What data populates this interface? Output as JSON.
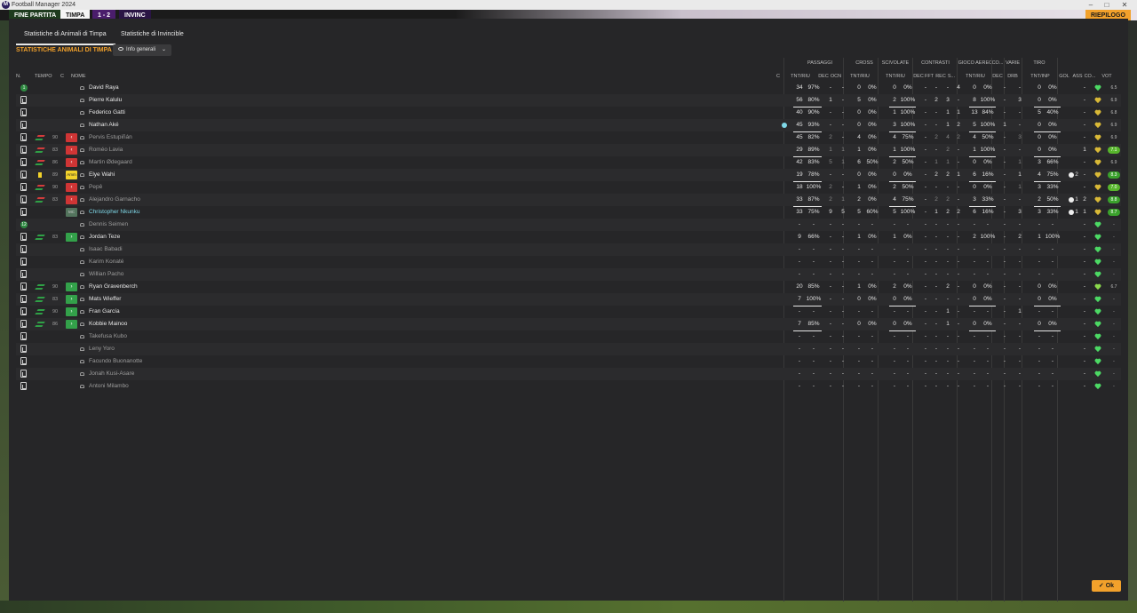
{
  "window": {
    "title": "Football Manager 2024",
    "app_icon": "M"
  },
  "topbar": {
    "end_button": "FINE PARTITA",
    "home_team": "TIMPA",
    "away_team": "INVINC",
    "score": "1 - 2",
    "right_label": "RIEPILOGO"
  },
  "tabs": [
    {
      "label": "Statistiche di Animali di Timpa",
      "active": true
    },
    {
      "label": "Statistiche di Invincible",
      "active": false
    }
  ],
  "section_title": "STATISTICHE ANIMALI DI TIMPA",
  "view_select": "Info generali",
  "groups": [
    "PASSAGGI",
    "CROSS",
    "SCIVOLATE",
    "CONTRASTI",
    "GIOCO AEREO",
    "CO...",
    "VARIE",
    "TIRO"
  ],
  "headers": {
    "n": "N.",
    "tempo": "TEMPO",
    "c": "C",
    "nome": "NOME",
    "c2": "C",
    "pass_tnt": "TNT/RIU",
    "pass_dec": "DEC",
    "pass_ocn": "OCN",
    "cross_tnt": "TNT/RIU",
    "scv_tnt": "TNT/RIU",
    "con_dec": "DEC",
    "con_fft": "FFT",
    "con_rec": "REC",
    "con_s": "S...",
    "aer_tnt": "TNT/RIU",
    "co_dec": "DEC",
    "var_drb": "DRB",
    "tiro_tnt": "TNT/INP",
    "gol": "GOL",
    "ass": "ASS",
    "cond": "CO...",
    "vot": "VOT"
  },
  "players": [
    {
      "n": "1",
      "starter": true,
      "evt": "",
      "tempo": "",
      "pos": "",
      "name": "David Raya",
      "style": "",
      "pt": "34",
      "pp": "97%",
      "pdec": "-",
      "pocn": "-",
      "ct": "0",
      "cp": "0%",
      "st": "0",
      "sp": "0%",
      "kdec": "-",
      "kfft": "-",
      "krec": "-",
      "ks": "4",
      "at": "0",
      "ap": "0%",
      "codec": "-",
      "drb": "-",
      "tt": "0",
      "tp": "0%",
      "gol": "",
      "ass": "-",
      "cond": "green",
      "vot": "6.5"
    },
    {
      "n": "",
      "starter": false,
      "evt": "",
      "tempo": "",
      "pos": "",
      "name": "Pierre Kalulu",
      "style": "",
      "pt": "56",
      "pp": "80%",
      "pdec": "1",
      "pocn": "-",
      "ct": "5",
      "cp": "0%",
      "st": "2",
      "sp": "100%",
      "kdec": "-",
      "kfft": "2",
      "krec": "3",
      "ks": "-",
      "at": "8",
      "ap": "100%",
      "codec": "-",
      "drb": "3",
      "tt": "0",
      "tp": "0%",
      "gol": "",
      "ass": "-",
      "cond": "yellow",
      "vot": "6.9"
    },
    {
      "n": "",
      "starter": false,
      "evt": "",
      "tempo": "",
      "pos": "",
      "name": "Federico Gatti",
      "style": "",
      "pt": "40",
      "pp": "90%",
      "pdec": "-",
      "pocn": "-",
      "ct": "0",
      "cp": "0%",
      "st": "1",
      "sp": "100%",
      "kdec": "-",
      "kfft": "-",
      "krec": "1",
      "ks": "1",
      "at": "13",
      "ap": "84%",
      "codec": "-",
      "drb": "-",
      "tt": "5",
      "tp": "40%",
      "gol": "",
      "ass": "-",
      "cond": "yellow",
      "vot": "6.8"
    },
    {
      "n": "",
      "starter": false,
      "evt": "",
      "tempo": "",
      "pos": "",
      "name": "Nathan Aké",
      "style": "",
      "pt": "45",
      "pp": "93%",
      "pdec": "-",
      "pocn": "-",
      "ct": "0",
      "cp": "0%",
      "st": "3",
      "sp": "100%",
      "kdec": "-",
      "kfft": "-",
      "krec": "1",
      "ks": "2",
      "at": "5",
      "ap": "100%",
      "codec": "1",
      "drb": "-",
      "tt": "0",
      "tp": "0%",
      "gol": "",
      "ass": "-",
      "cond": "yellow",
      "vot": "6.9"
    },
    {
      "n": "",
      "starter": false,
      "evt": "sub",
      "tempo": "90",
      "pos": "red",
      "name": "Pervis Estupiñán",
      "style": "dim",
      "pt": "45",
      "pp": "82%",
      "pdec": "2",
      "pocn": "-",
      "ct": "4",
      "cp": "0%",
      "st": "4",
      "sp": "75%",
      "kdec": "-",
      "kfft": "2",
      "krec": "4",
      "ks": "2",
      "at": "4",
      "ap": "50%",
      "codec": "-",
      "drb": "3",
      "tt": "0",
      "tp": "0%",
      "gol": "",
      "ass": "-",
      "cond": "yellow",
      "vot": "6.9"
    },
    {
      "n": "",
      "starter": false,
      "evt": "sub",
      "tempo": "83",
      "pos": "red",
      "name": "Roméo Lavia",
      "style": "dim",
      "pt": "29",
      "pp": "89%",
      "pdec": "1",
      "pocn": "1",
      "ct": "1",
      "cp": "0%",
      "st": "1",
      "sp": "100%",
      "kdec": "-",
      "kfft": "-",
      "krec": "2",
      "ks": "-",
      "at": "1",
      "ap": "100%",
      "codec": "-",
      "drb": "-",
      "tt": "0",
      "tp": "0%",
      "gol": "",
      "ass": "1",
      "cond": "yellow",
      "vot": "7.1"
    },
    {
      "n": "",
      "starter": false,
      "evt": "sub",
      "tempo": "86",
      "pos": "red",
      "name": "Martin Ødegaard",
      "style": "dim",
      "pt": "42",
      "pp": "83%",
      "pdec": "5",
      "pocn": "1",
      "ct": "6",
      "cp": "50%",
      "st": "2",
      "sp": "50%",
      "kdec": "-",
      "kfft": "1",
      "krec": "1",
      "ks": "-",
      "at": "0",
      "ap": "0%",
      "codec": "-",
      "drb": "1",
      "tt": "3",
      "tp": "66%",
      "gol": "",
      "ass": "-",
      "cond": "yellow",
      "vot": "6.9"
    },
    {
      "n": "",
      "starter": false,
      "evt": "yellow",
      "tempo": "89",
      "pos": "yellow",
      "posl": "Amm",
      "name": "Elye Wahi",
      "style": "",
      "pt": "19",
      "pp": "78%",
      "pdec": "-",
      "pocn": "-",
      "ct": "0",
      "cp": "0%",
      "st": "0",
      "sp": "0%",
      "kdec": "-",
      "kfft": "2",
      "krec": "2",
      "ks": "1",
      "at": "6",
      "ap": "16%",
      "codec": "-",
      "drb": "1",
      "tt": "4",
      "tp": "75%",
      "gol": "2",
      "ass": "-",
      "cond": "yellow",
      "vot": "8.3"
    },
    {
      "n": "",
      "starter": false,
      "evt": "sub",
      "tempo": "90",
      "pos": "red",
      "name": "Pepê",
      "style": "dim",
      "pt": "18",
      "pp": "100%",
      "pdec": "2",
      "pocn": "-",
      "ct": "1",
      "cp": "0%",
      "st": "2",
      "sp": "50%",
      "kdec": "-",
      "kfft": "-",
      "krec": "-",
      "ks": "-",
      "at": "0",
      "ap": "0%",
      "codec": "-",
      "drb": "1",
      "tt": "3",
      "tp": "33%",
      "gol": "",
      "ass": "-",
      "cond": "yellow",
      "vot": "7.0"
    },
    {
      "n": "",
      "starter": false,
      "evt": "sub",
      "tempo": "83",
      "pos": "red",
      "name": "Alejandro Garnacho",
      "style": "dim",
      "pt": "33",
      "pp": "87%",
      "pdec": "2",
      "pocn": "1",
      "ct": "2",
      "cp": "0%",
      "st": "4",
      "sp": "75%",
      "kdec": "-",
      "kfft": "2",
      "krec": "2",
      "ks": "-",
      "at": "3",
      "ap": "33%",
      "codec": "-",
      "drb": "-",
      "tt": "2",
      "tp": "50%",
      "gol": "1",
      "ass": "2",
      "cond": "yellow",
      "vot": "8.8"
    },
    {
      "n": "",
      "starter": false,
      "evt": "",
      "tempo": "",
      "pos": "gray",
      "posl": "MC",
      "name": "Christopher Nkunku",
      "style": "link",
      "pt": "33",
      "pp": "75%",
      "pdec": "9",
      "pocn": "5",
      "ct": "5",
      "cp": "60%",
      "st": "5",
      "sp": "100%",
      "kdec": "-",
      "kfft": "1",
      "krec": "2",
      "ks": "2",
      "at": "6",
      "ap": "16%",
      "codec": "-",
      "drb": "3",
      "tt": "3",
      "tp": "33%",
      "gol": "1",
      "ass": "1",
      "cond": "yellow",
      "vot": "8.7"
    },
    {
      "n": "12",
      "starter": true,
      "evt": "",
      "tempo": "",
      "pos": "",
      "name": "Dennis Seimen",
      "style": "dim",
      "pt": "-",
      "pp": "-",
      "pdec": "-",
      "pocn": "-",
      "ct": "-",
      "cp": "-",
      "st": "-",
      "sp": "-",
      "kdec": "-",
      "kfft": "-",
      "krec": "-",
      "ks": "-",
      "at": "-",
      "ap": "-",
      "codec": "-",
      "drb": "-",
      "tt": "-",
      "tp": "-",
      "gol": "",
      "ass": "-",
      "cond": "green",
      "vot": "-"
    },
    {
      "n": "",
      "starter": false,
      "evt": "subin",
      "tempo": "83",
      "pos": "green",
      "name": "Jordan Teze",
      "style": "",
      "pt": "9",
      "pp": "66%",
      "pdec": "-",
      "pocn": "-",
      "ct": "1",
      "cp": "0%",
      "st": "1",
      "sp": "0%",
      "kdec": "-",
      "kfft": "-",
      "krec": "-",
      "ks": "-",
      "at": "2",
      "ap": "100%",
      "codec": "-",
      "drb": "2",
      "tt": "1",
      "tp": "100%",
      "gol": "",
      "ass": "-",
      "cond": "green",
      "vot": "-"
    },
    {
      "n": "",
      "starter": false,
      "evt": "",
      "tempo": "",
      "pos": "",
      "name": "Isaac Babadi",
      "style": "dim",
      "pt": "-",
      "pp": "-",
      "pdec": "-",
      "pocn": "-",
      "ct": "-",
      "cp": "-",
      "st": "-",
      "sp": "-",
      "kdec": "-",
      "kfft": "-",
      "krec": "-",
      "ks": "-",
      "at": "-",
      "ap": "-",
      "codec": "-",
      "drb": "-",
      "tt": "-",
      "tp": "-",
      "gol": "",
      "ass": "-",
      "cond": "green",
      "vot": "-"
    },
    {
      "n": "",
      "starter": false,
      "evt": "",
      "tempo": "",
      "pos": "",
      "name": "Karim Konaté",
      "style": "dim",
      "pt": "-",
      "pp": "-",
      "pdec": "-",
      "pocn": "-",
      "ct": "-",
      "cp": "-",
      "st": "-",
      "sp": "-",
      "kdec": "-",
      "kfft": "-",
      "krec": "-",
      "ks": "-",
      "at": "-",
      "ap": "-",
      "codec": "-",
      "drb": "-",
      "tt": "-",
      "tp": "-",
      "gol": "",
      "ass": "-",
      "cond": "green",
      "vot": "-"
    },
    {
      "n": "",
      "starter": false,
      "evt": "",
      "tempo": "",
      "pos": "",
      "name": "Willian Pacho",
      "style": "dim",
      "pt": "-",
      "pp": "-",
      "pdec": "-",
      "pocn": "-",
      "ct": "-",
      "cp": "-",
      "st": "-",
      "sp": "-",
      "kdec": "-",
      "kfft": "-",
      "krec": "-",
      "ks": "-",
      "at": "-",
      "ap": "-",
      "codec": "-",
      "drb": "-",
      "tt": "-",
      "tp": "-",
      "gol": "",
      "ass": "-",
      "cond": "green",
      "vot": "-"
    },
    {
      "n": "",
      "starter": false,
      "evt": "subin",
      "tempo": "90",
      "pos": "green",
      "name": "Ryan Gravenberch",
      "style": "",
      "pt": "20",
      "pp": "85%",
      "pdec": "-",
      "pocn": "-",
      "ct": "1",
      "cp": "0%",
      "st": "2",
      "sp": "0%",
      "kdec": "-",
      "kfft": "-",
      "krec": "2",
      "ks": "-",
      "at": "0",
      "ap": "0%",
      "codec": "-",
      "drb": "-",
      "tt": "0",
      "tp": "0%",
      "gol": "",
      "ass": "-",
      "cond": "lime",
      "vot": "6.7"
    },
    {
      "n": "",
      "starter": false,
      "evt": "subin",
      "tempo": "83",
      "pos": "green",
      "name": "Mats Wieffer",
      "style": "",
      "pt": "7",
      "pp": "100%",
      "pdec": "-",
      "pocn": "-",
      "ct": "0",
      "cp": "0%",
      "st": "0",
      "sp": "0%",
      "kdec": "-",
      "kfft": "-",
      "krec": "-",
      "ks": "-",
      "at": "0",
      "ap": "0%",
      "codec": "-",
      "drb": "-",
      "tt": "0",
      "tp": "0%",
      "gol": "",
      "ass": "-",
      "cond": "green",
      "vot": "-"
    },
    {
      "n": "",
      "starter": false,
      "evt": "subin",
      "tempo": "90",
      "pos": "green",
      "name": "Fran García",
      "style": "",
      "pt": "-",
      "pp": "-",
      "pdec": "-",
      "pocn": "-",
      "ct": "-",
      "cp": "-",
      "st": "-",
      "sp": "-",
      "kdec": "-",
      "kfft": "-",
      "krec": "1",
      "ks": "-",
      "at": "-",
      "ap": "-",
      "codec": "-",
      "drb": "1",
      "tt": "-",
      "tp": "-",
      "gol": "",
      "ass": "-",
      "cond": "green",
      "vot": "-"
    },
    {
      "n": "",
      "starter": false,
      "evt": "subin",
      "tempo": "86",
      "pos": "green",
      "name": "Kobbie Mainoo",
      "style": "",
      "pt": "7",
      "pp": "85%",
      "pdec": "-",
      "pocn": "-",
      "ct": "0",
      "cp": "0%",
      "st": "0",
      "sp": "0%",
      "kdec": "-",
      "kfft": "-",
      "krec": "1",
      "ks": "-",
      "at": "0",
      "ap": "0%",
      "codec": "-",
      "drb": "-",
      "tt": "0",
      "tp": "0%",
      "gol": "",
      "ass": "-",
      "cond": "green",
      "vot": "-"
    },
    {
      "n": "",
      "starter": false,
      "evt": "",
      "tempo": "",
      "pos": "",
      "name": "Takefusa Kubo",
      "style": "dim",
      "pt": "-",
      "pp": "-",
      "pdec": "-",
      "pocn": "-",
      "ct": "-",
      "cp": "-",
      "st": "-",
      "sp": "-",
      "kdec": "-",
      "kfft": "-",
      "krec": "-",
      "ks": "-",
      "at": "-",
      "ap": "-",
      "codec": "-",
      "drb": "-",
      "tt": "-",
      "tp": "-",
      "gol": "",
      "ass": "-",
      "cond": "green",
      "vot": "-"
    },
    {
      "n": "",
      "starter": false,
      "evt": "",
      "tempo": "",
      "pos": "",
      "name": "Leny Yoro",
      "style": "dim",
      "pt": "-",
      "pp": "-",
      "pdec": "-",
      "pocn": "-",
      "ct": "-",
      "cp": "-",
      "st": "-",
      "sp": "-",
      "kdec": "-",
      "kfft": "-",
      "krec": "-",
      "ks": "-",
      "at": "-",
      "ap": "-",
      "codec": "-",
      "drb": "-",
      "tt": "-",
      "tp": "-",
      "gol": "",
      "ass": "-",
      "cond": "green",
      "vot": "-"
    },
    {
      "n": "",
      "starter": false,
      "evt": "",
      "tempo": "",
      "pos": "",
      "name": "Facundo Buonanotte",
      "style": "dim",
      "pt": "-",
      "pp": "-",
      "pdec": "-",
      "pocn": "-",
      "ct": "-",
      "cp": "-",
      "st": "-",
      "sp": "-",
      "kdec": "-",
      "kfft": "-",
      "krec": "-",
      "ks": "-",
      "at": "-",
      "ap": "-",
      "codec": "-",
      "drb": "-",
      "tt": "-",
      "tp": "-",
      "gol": "",
      "ass": "-",
      "cond": "green",
      "vot": "-"
    },
    {
      "n": "",
      "starter": false,
      "evt": "",
      "tempo": "",
      "pos": "",
      "name": "Jonah Kusi-Asare",
      "style": "dim",
      "pt": "-",
      "pp": "-",
      "pdec": "-",
      "pocn": "-",
      "ct": "-",
      "cp": "-",
      "st": "-",
      "sp": "-",
      "kdec": "-",
      "kfft": "-",
      "krec": "-",
      "ks": "-",
      "at": "-",
      "ap": "-",
      "codec": "-",
      "drb": "-",
      "tt": "-",
      "tp": "-",
      "gol": "",
      "ass": "-",
      "cond": "green",
      "vot": "-"
    },
    {
      "n": "",
      "starter": false,
      "evt": "",
      "tempo": "",
      "pos": "",
      "name": "Antoni Milambo",
      "style": "dim",
      "pt": "-",
      "pp": "-",
      "pdec": "-",
      "pocn": "-",
      "ct": "-",
      "cp": "-",
      "st": "-",
      "sp": "-",
      "kdec": "-",
      "kfft": "-",
      "krec": "-",
      "ks": "-",
      "at": "-",
      "ap": "-",
      "codec": "-",
      "drb": "-",
      "tt": "-",
      "tp": "-",
      "gol": "",
      "ass": "-",
      "cond": "green",
      "vot": "-"
    }
  ],
  "ok_button": "Ok",
  "colors": {
    "accent": "#f2a12b",
    "panel": "#262628",
    "red_badge": "#cf3535",
    "green_badge": "#33a14a"
  }
}
